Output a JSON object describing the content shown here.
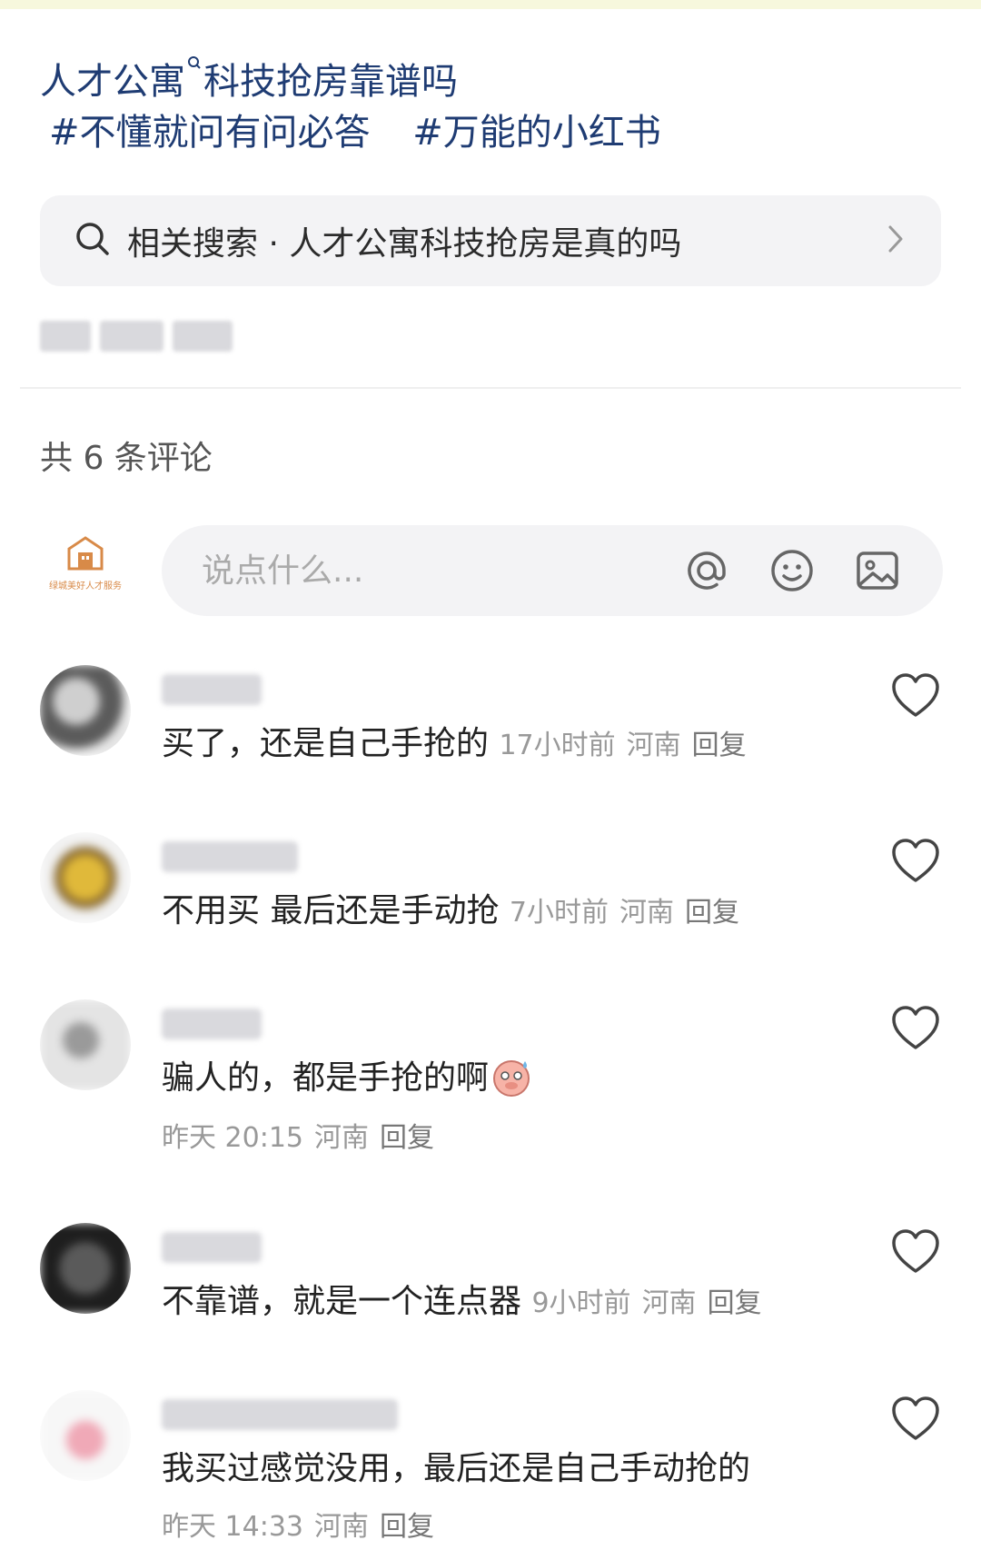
{
  "post": {
    "title": "人才公寓",
    "title_rest": "科技抢房靠谱吗",
    "title_search_icon": "search-small-icon",
    "hashtags": [
      "#不懂就问有问必答",
      "#万能的小红书"
    ]
  },
  "related_search": {
    "label": "相关搜索 · 人才公寓科技抢房是真的吗",
    "icon": "search-icon",
    "chevron": "chevron-right-icon"
  },
  "comments_header": {
    "count_label": "共 6 条评论"
  },
  "composer": {
    "placeholder": "说点什么...",
    "logo_text": "绿城美好人才服务",
    "tools": [
      "at-icon",
      "emoji-icon",
      "image-icon"
    ]
  },
  "comments": [
    {
      "text": "买了，还是自己手抢的",
      "time": "17小时前",
      "location": "河南",
      "reply": "回复"
    },
    {
      "text": "不用买 最后还是手动抢",
      "time": "7小时前",
      "location": "河南",
      "reply": "回复"
    },
    {
      "text": "骗人的，都是手抢的啊",
      "time": "昨天 20:15",
      "location": "河南",
      "reply": "回复",
      "emoji": "sweating-pig-emoji"
    },
    {
      "text": "不靠谱，就是一个连点器",
      "time": "9小时前",
      "location": "河南",
      "reply": "回复"
    },
    {
      "text": "我买过感觉没用，最后还是自己手动抢的",
      "time": "昨天 14:33",
      "location": "河南",
      "reply": "回复"
    }
  ],
  "colors": {
    "link_blue": "#1f3c73",
    "meta_gray": "#999999",
    "box_bg": "#f3f3f5",
    "top_strip": "#f7f8dd"
  }
}
